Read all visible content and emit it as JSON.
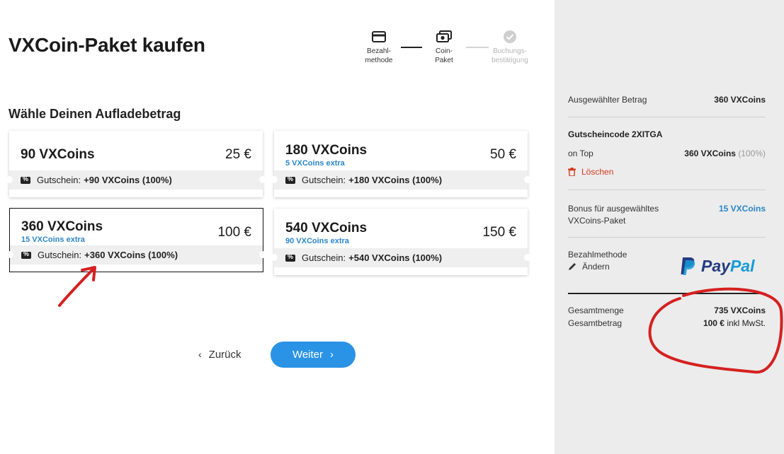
{
  "page": {
    "title": "VXCoin-Paket kaufen",
    "section_title": "Wähle Deinen Aufladebetrag"
  },
  "stepper": {
    "steps": [
      {
        "label_line1": "Bezahl-",
        "label_line2": "methode",
        "icon": "credit-card-icon",
        "state": "done"
      },
      {
        "label_line1": "Coin-",
        "label_line2": "Paket",
        "icon": "cash-icon",
        "state": "active"
      },
      {
        "label_line1": "Buchungs-",
        "label_line2": "bestätigung",
        "icon": "check-circle-icon",
        "state": "inactive"
      }
    ]
  },
  "packages": [
    {
      "name": "90 VXCoins",
      "price": "25 €",
      "extra": "",
      "voucher_label": "Gutschein:",
      "voucher_value": "+90 VXCoins (100%)",
      "selected": false
    },
    {
      "name": "180 VXCoins",
      "price": "50 €",
      "extra": "5 VXCoins extra",
      "voucher_label": "Gutschein:",
      "voucher_value": "+180 VXCoins (100%)",
      "selected": false
    },
    {
      "name": "360 VXCoins",
      "price": "100 €",
      "extra": "15 VXCoins extra",
      "voucher_label": "Gutschein:",
      "voucher_value": "+360 VXCoins (100%)",
      "selected": true
    },
    {
      "name": "540 VXCoins",
      "price": "150 €",
      "extra": "90 VXCoins extra",
      "voucher_label": "Gutschein:",
      "voucher_value": "+540 VXCoins (100%)",
      "selected": false
    }
  ],
  "nav": {
    "back_label": "Zurück",
    "next_label": "Weiter"
  },
  "summary": {
    "selected_amount_label": "Ausgewählter Betrag",
    "selected_amount_value": "360 VXCoins",
    "voucher_code_label": "Gutscheincode 2XITGA",
    "on_top_label": "on Top",
    "on_top_value": "360 VXCoins",
    "on_top_percent": "(100%)",
    "delete_label": "Löschen",
    "bonus_label_line1": "Bonus für ausgewähltes",
    "bonus_label_line2": "VXCoins-Paket",
    "bonus_value": "15 VXCoins",
    "payment_label": "Bezahlmethode",
    "change_label": "Ändern",
    "paypal_pay": "Pay",
    "paypal_pal": "Pal",
    "total_qty_label": "Gesamtmenge",
    "total_qty_value": "735 VXCoins",
    "total_amount_label": "Gesamtbetrag",
    "total_amount_value": "100 €",
    "total_amount_suffix": "inkl MwSt."
  },
  "colors": {
    "accent_blue": "#2a93e6",
    "link_blue": "#2a86c9",
    "delete_red": "#d23a1f",
    "annotation_red": "#d62020",
    "sidebar_bg": "#ececec",
    "paypal_dark": "#253b80",
    "paypal_light": "#179bd7"
  }
}
